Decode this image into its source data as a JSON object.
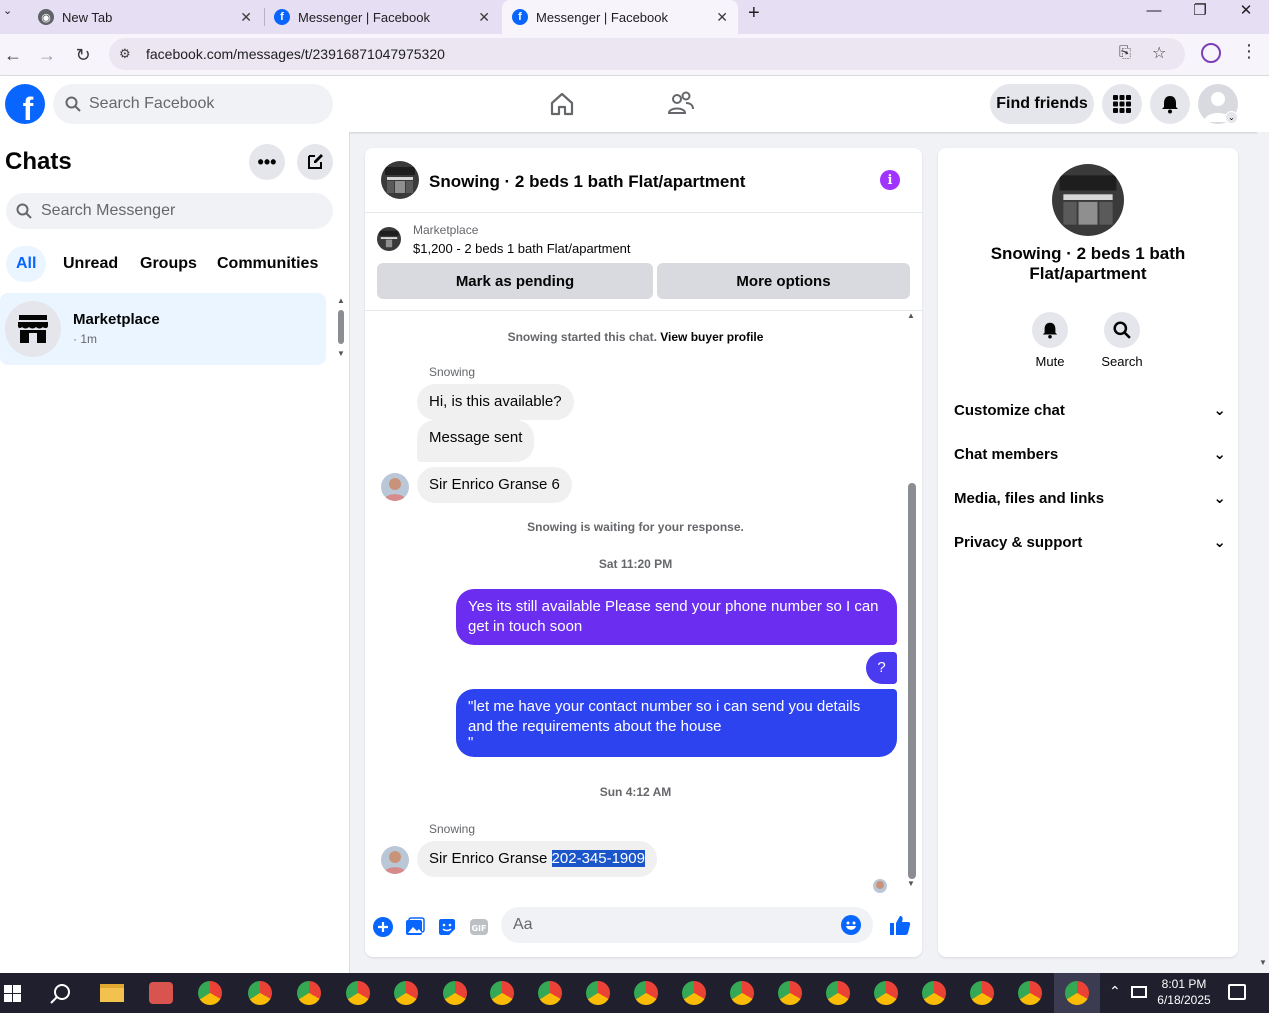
{
  "browser": {
    "tabs": [
      {
        "title": "New Tab",
        "icon": "chrome-icon"
      },
      {
        "title": "Messenger | Facebook",
        "icon": "facebook-icon"
      },
      {
        "title": "Messenger | Facebook",
        "icon": "facebook-icon",
        "active": true
      }
    ],
    "url": "facebook.com/messages/t/23916871047975320"
  },
  "header": {
    "search_placeholder": "Search Facebook",
    "find_friends": "Find friends"
  },
  "sidebar": {
    "title": "Chats",
    "search_placeholder": "Search Messenger",
    "filters": [
      "All",
      "Unread",
      "Groups",
      "Communities"
    ],
    "chats": [
      {
        "name": "Marketplace",
        "time": "· 1m"
      }
    ]
  },
  "conversation": {
    "title": "Snowing · 2 beds 1 bath Flat/apartment",
    "marketplace_label": "Marketplace",
    "listing": "$1,200 - 2 beds 1 bath Flat/apartment",
    "mark_pending": "Mark as pending",
    "more_options": "More options",
    "started_text": "Snowing started this chat.",
    "view_profile": "View buyer profile",
    "sender1": "Snowing",
    "msg1": "Hi, is this available?",
    "msg2": "Message sent",
    "msg3": "Sir Enrico Granse 6",
    "waiting": "Snowing is waiting for your response.",
    "ts1": "Sat 11:20 PM",
    "out1": "Yes its still available Please send your phone number so I can get in touch soon",
    "out2": "?",
    "out3a": "\"let me have your contact number so i can send you details and the requirements about the house",
    "out3b": "\"",
    "ts2": "Sun 4:12 AM",
    "sender2": "Snowing",
    "msg4_prefix": "Sir Enrico Granse ",
    "msg4_selected": "202-345-1909",
    "composer_placeholder": "Aa",
    "colors": {
      "out_top": "#6b2ef0",
      "out_mid": "#4a3af0",
      "out_bottom": "#2d43f0"
    }
  },
  "info_panel": {
    "title": "Snowing · 2 beds 1 bath Flat/apartment",
    "mute": "Mute",
    "search": "Search",
    "rows": [
      "Customize chat",
      "Chat members",
      "Media, files and links",
      "Privacy & support"
    ]
  },
  "taskbar": {
    "time": "8:01 PM",
    "date": "6/18/2025"
  }
}
